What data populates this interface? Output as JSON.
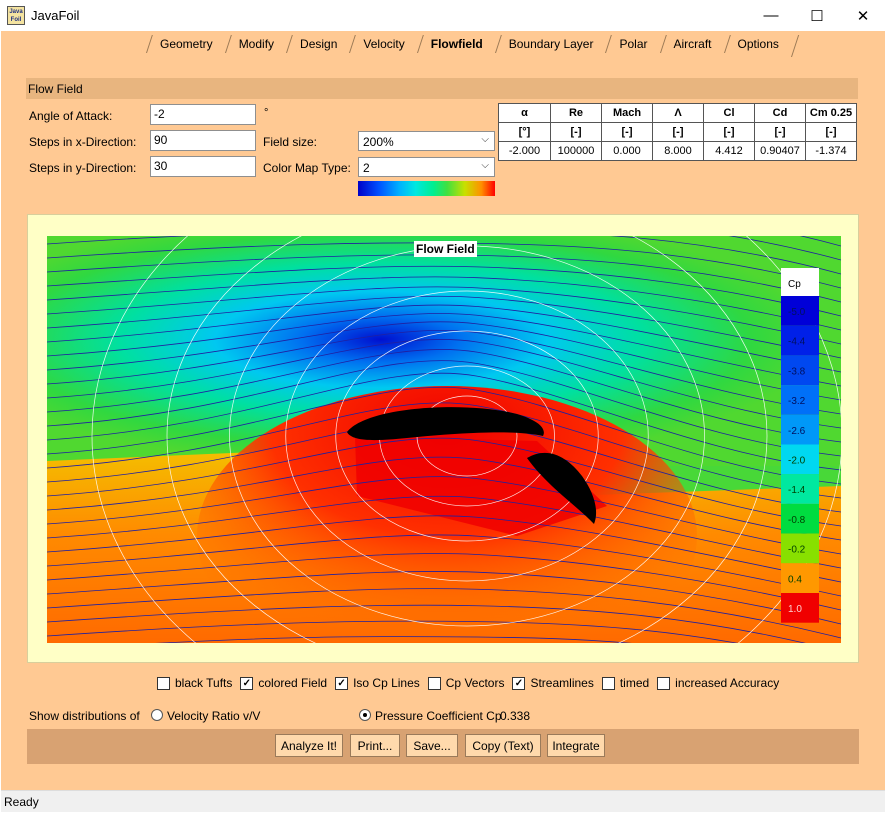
{
  "window": {
    "title": "JavaFoil",
    "icon_text": "Java Foil",
    "minimize": "—",
    "maximize": "☐",
    "close": "✕"
  },
  "tabs": [
    {
      "label": "Geometry"
    },
    {
      "label": "Modify"
    },
    {
      "label": "Design"
    },
    {
      "label": "Velocity"
    },
    {
      "label": "Flowfield"
    },
    {
      "label": "Boundary Layer"
    },
    {
      "label": "Polar"
    },
    {
      "label": "Aircraft"
    },
    {
      "label": "Options"
    }
  ],
  "section": {
    "title": "Flow Field"
  },
  "form": {
    "angle_label": "Angle of Attack:",
    "angle_value": "-2",
    "angle_unit": "°",
    "steps_x_label": "Steps in x-Direction:",
    "steps_x_value": "90",
    "steps_y_label": "Steps in y-Direction:",
    "steps_y_value": "30",
    "field_size_label": "Field size:",
    "field_size_value": "200%",
    "color_map_label": "Color Map Type:",
    "color_map_value": "2"
  },
  "results": {
    "headers": [
      "α",
      "Re",
      "Mach",
      "Λ",
      "Cl",
      "Cd",
      "Cm 0.25"
    ],
    "units": [
      "[°]",
      "[-]",
      "[-]",
      "[-]",
      "[-]",
      "[-]",
      "[-]"
    ],
    "values": [
      "-2.000",
      "100000",
      "0.000",
      "8.000",
      "4.412",
      "0.90407",
      "-1.374"
    ]
  },
  "plot": {
    "title": "Flow Field",
    "legend_title": "Cp",
    "legend": [
      {
        "label": "-5.0",
        "color": "#0000d8"
      },
      {
        "label": "-4.4",
        "color": "#0020e8"
      },
      {
        "label": "-3.8",
        "color": "#0048f0"
      },
      {
        "label": "-3.2",
        "color": "#0070f8"
      },
      {
        "label": "-2.6",
        "color": "#0098f8"
      },
      {
        "label": "-2.0",
        "color": "#00d8f0"
      },
      {
        "label": "-1.4",
        "color": "#00e8a0"
      },
      {
        "label": "-0.8",
        "color": "#00dc40"
      },
      {
        "label": "-0.2",
        "color": "#88e000"
      },
      {
        "label": "0.4",
        "color": "#ff9800"
      },
      {
        "label": "1.0",
        "color": "#f00000"
      }
    ]
  },
  "options": [
    {
      "label": "black Tufts",
      "checked": "",
      "name": "black-tufts-checkbox"
    },
    {
      "label": "colored Field",
      "checked": "✓",
      "name": "colored-field-checkbox"
    },
    {
      "label": "Iso Cp Lines",
      "checked": "✓",
      "name": "iso-cp-lines-checkbox"
    },
    {
      "label": "Cp Vectors",
      "checked": "",
      "name": "cp-vectors-checkbox"
    },
    {
      "label": "Streamlines",
      "checked": "✓",
      "name": "streamlines-checkbox"
    },
    {
      "label": "timed",
      "checked": "",
      "name": "timed-checkbox"
    },
    {
      "label": "increased Accuracy",
      "checked": "",
      "name": "increased-accuracy-checkbox"
    }
  ],
  "distribution": {
    "label": "Show distributions of",
    "velocity_option": "Velocity Ratio v/V",
    "pressure_option": "Pressure Coefficient Cp",
    "value": "0.338"
  },
  "buttons": {
    "analyze": "Analyze It!",
    "print": "Print...",
    "save": "Save...",
    "copy": "Copy (Text)",
    "integrate": "Integrate"
  },
  "status": {
    "text": "Ready"
  }
}
